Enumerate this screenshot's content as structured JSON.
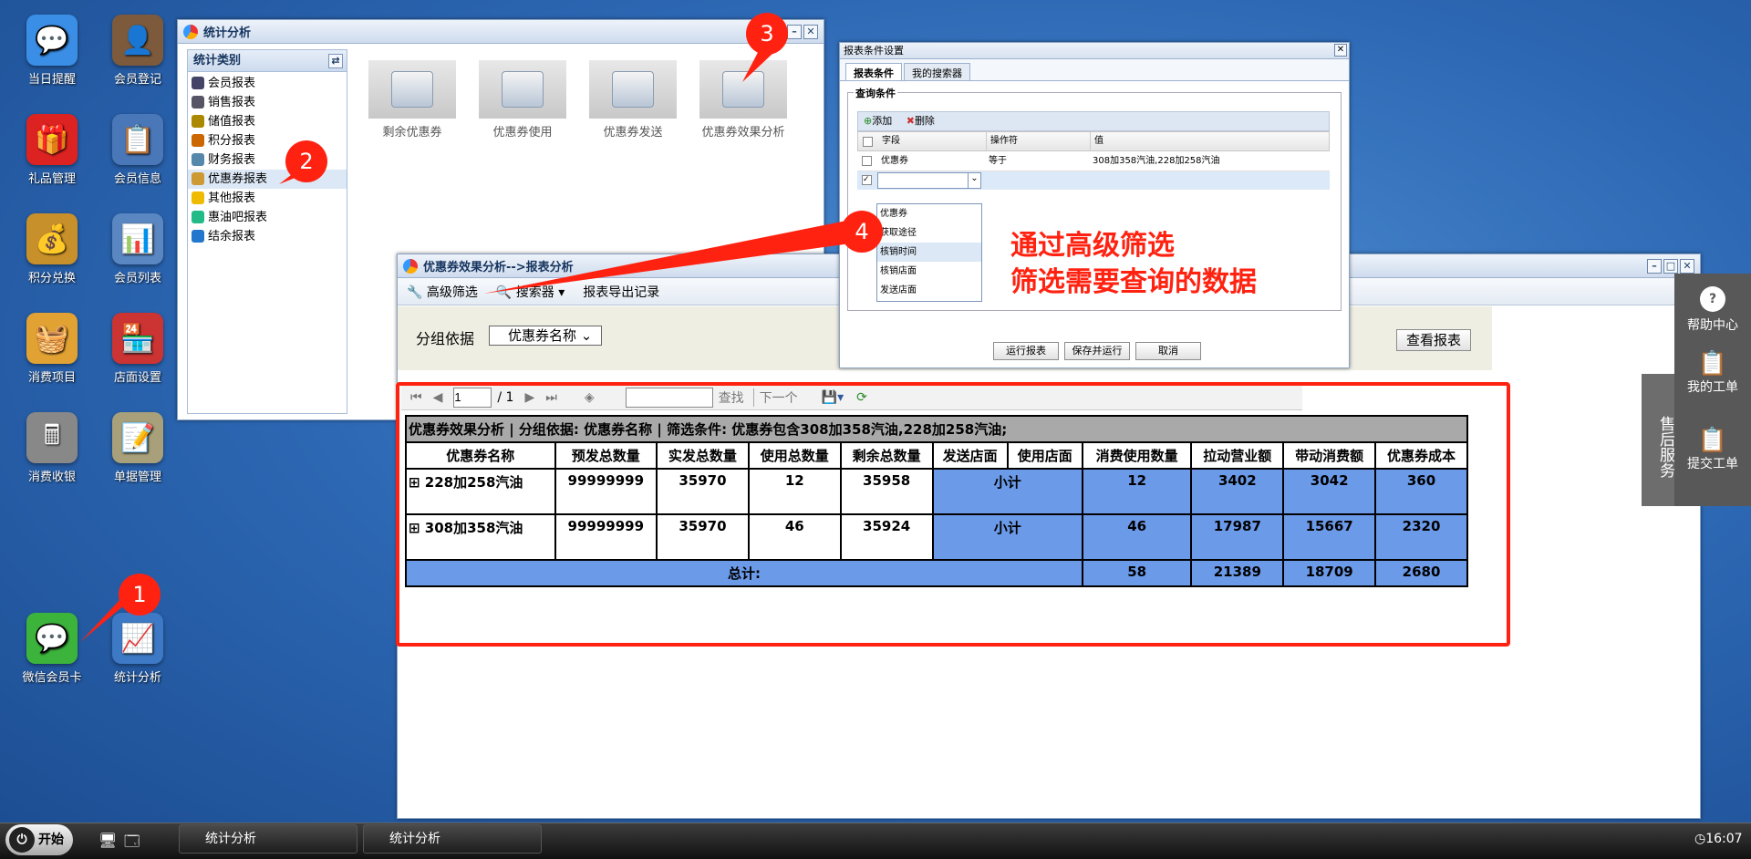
{
  "desktop": [
    {
      "label": "当日提醒",
      "color": "#3a8ee6",
      "glyph": "💬"
    },
    {
      "label": "会员登记",
      "color": "#7d5a3c",
      "glyph": "👤"
    },
    {
      "label": "礼品管理",
      "color": "#d22",
      "glyph": "🎁"
    },
    {
      "label": "会员信息",
      "color": "#4a77b8",
      "glyph": "📋"
    },
    {
      "label": "积分兑换",
      "color": "#c8902a",
      "glyph": "💰"
    },
    {
      "label": "会员列表",
      "color": "#5a86c2",
      "glyph": "📊"
    },
    {
      "label": "消费项目",
      "color": "#e2a233",
      "glyph": "🧺"
    },
    {
      "label": "店面设置",
      "color": "#c33",
      "glyph": "🏪"
    },
    {
      "label": "消费收银",
      "color": "#888",
      "glyph": "🖩"
    },
    {
      "label": "单据管理",
      "color": "#a7a07a",
      "glyph": "📝"
    },
    {
      "label": "微信会员卡",
      "color": "#3cb43c",
      "glyph": "💬"
    },
    {
      "label": "统计分析",
      "color": "#3d79c4",
      "glyph": "📈"
    }
  ],
  "stats_window": {
    "title": "统计分析",
    "tree_header": "统计类别",
    "tree": [
      "会员报表",
      "销售报表",
      "储值报表",
      "积分报表",
      "财务报表",
      "优惠券报表",
      "其他报表",
      "惠油吧报表",
      "结余报表"
    ],
    "icons": [
      "剩余优惠券",
      "优惠券使用",
      "优惠券发送",
      "优惠券效果分析"
    ]
  },
  "report_window": {
    "title": "优惠券效果分析-->报表分析",
    "toolbar": [
      "高级筛选",
      "搜索器 ▾",
      "报表导出记录"
    ],
    "group_label": "分组依据",
    "group_value": "优惠券名称",
    "view_button": "查看报表",
    "pager": {
      "page": "1",
      "total": "/ 1",
      "find": "查找",
      "next": "下一个"
    },
    "table_title": "优惠券效果分析 | 分组依据: 优惠券名称 | 筛选条件:  优惠券包含308加358汽油,228加258汽油;",
    "headers": [
      "优惠券名称",
      "预发总数量",
      "实发总数量",
      "使用总数量",
      "剩余总数量",
      "发送店面",
      "使用店面",
      "消费使用数量",
      "拉动营业额",
      "带动消费额",
      "优惠券成本"
    ],
    "rows": [
      {
        "name": "⊞ 228加258汽油",
        "pre": "99999999",
        "act": "35970",
        "used": "12",
        "left": "35958",
        "sub": "小计",
        "qty": "12",
        "rev": "3402",
        "cons": "3042",
        "cost": "360"
      },
      {
        "name": "⊞ 308加358汽油",
        "pre": "99999999",
        "act": "35970",
        "used": "46",
        "left": "35924",
        "sub": "小计",
        "qty": "46",
        "rev": "17987",
        "cons": "15667",
        "cost": "2320"
      }
    ],
    "total": {
      "label": "总计:",
      "qty": "58",
      "rev": "21389",
      "cons": "18709",
      "cost": "2680"
    }
  },
  "condition_dialog": {
    "title": "报表条件设置",
    "tabs": [
      "报表条件",
      "我的搜索器"
    ],
    "fieldset": "查询条件",
    "add": "添加",
    "del": "删除",
    "cols": [
      "字段",
      "操作符",
      "值"
    ],
    "row": {
      "field": "优惠券",
      "op": "等于",
      "value": "308加358汽油,228加258汽油"
    },
    "dropdown": [
      "优惠券",
      "获取途径",
      "核销时间",
      "核销店面",
      "发送店面"
    ],
    "buttons": [
      "运行报表",
      "保存并运行",
      "取消"
    ]
  },
  "annotation": {
    "line1": "通过高级筛选",
    "line2": "筛选需要查询的数据"
  },
  "markers": [
    "1",
    "2",
    "3",
    "4"
  ],
  "side_panel": {
    "service": "售后服务",
    "items": [
      "帮助中心",
      "我的工单",
      "提交工单"
    ]
  },
  "taskbar": {
    "start": "开始",
    "tasks": [
      "统计分析",
      "统计分析"
    ],
    "clock": "16:07"
  }
}
